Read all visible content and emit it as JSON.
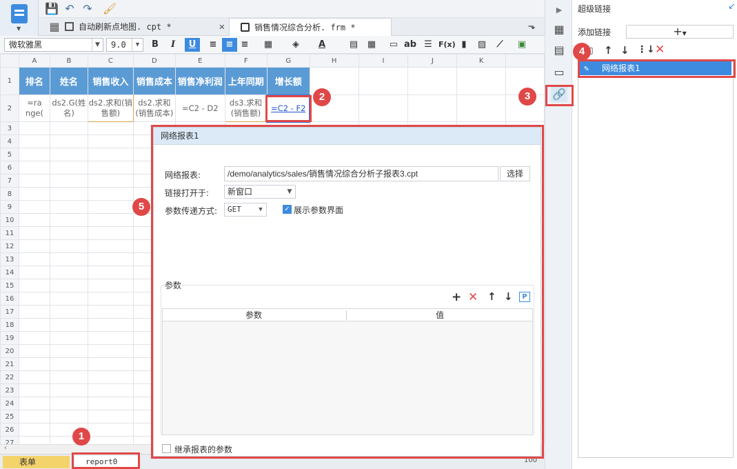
{
  "toolbar": {
    "icons": [
      "save-icon",
      "undo-icon",
      "redo-icon",
      "brush-icon"
    ]
  },
  "tabs": [
    {
      "label": "自动刷新点地图. cpt *"
    },
    {
      "label": "销售情况综合分析. frm *"
    }
  ],
  "format": {
    "font": "微软雅黑",
    "size": "9.0",
    "bold": "B",
    "italic": "I",
    "underline": "U",
    "ab": "ab",
    "fx": "F(x)"
  },
  "sheet": {
    "col_headers": [
      "A",
      "B",
      "C",
      "D",
      "E",
      "F",
      "G",
      "H",
      "I",
      "J",
      "K"
    ],
    "row_numbers": [
      "1",
      "2",
      "3",
      "4",
      "5",
      "6",
      "7",
      "8",
      "9",
      "10",
      "11",
      "12",
      "13",
      "14",
      "15",
      "16",
      "17",
      "18",
      "19",
      "20",
      "21",
      "22",
      "23",
      "24",
      "25",
      "26",
      "27"
    ],
    "header_row": [
      "排名",
      "姓名",
      "销售收入",
      "销售成本",
      "销售净利润",
      "上年同期",
      "增长额"
    ],
    "data_row": [
      "=ra nge(",
      "ds2.G(姓名)",
      "ds2.求和(销售额)",
      "ds2.求和(销售成本)",
      "=C2 - D2",
      "ds3.求和(销售额)",
      "=C2 - F2"
    ]
  },
  "bottom": {
    "sheet_tab1": "表单",
    "sheet_tab2": "report0",
    "zoom": "100"
  },
  "panel": {
    "title": "超级链接",
    "add_label": "添加链接",
    "add_button": "+",
    "item": "网络报表1"
  },
  "dialog": {
    "title": "网络报表1",
    "report_label": "网络报表:",
    "report_path": "/demo/analytics/sales/销售情况综合分析子报表3.cpt",
    "choose": "选择",
    "open_label": "链接打开于:",
    "open_value": "新窗口",
    "method_label": "参数传递方式:",
    "method_value": "GET",
    "show_params": "展示参数界面",
    "params_label": "参数",
    "col_param": "参数",
    "col_value": "值",
    "inherit": "继承报表的参数"
  },
  "badges": [
    "1",
    "2",
    "3",
    "4",
    "5"
  ],
  "colors": {
    "accent": "#3d8be0",
    "header_fill": "#5b9bd5",
    "highlight": "#e04848"
  }
}
